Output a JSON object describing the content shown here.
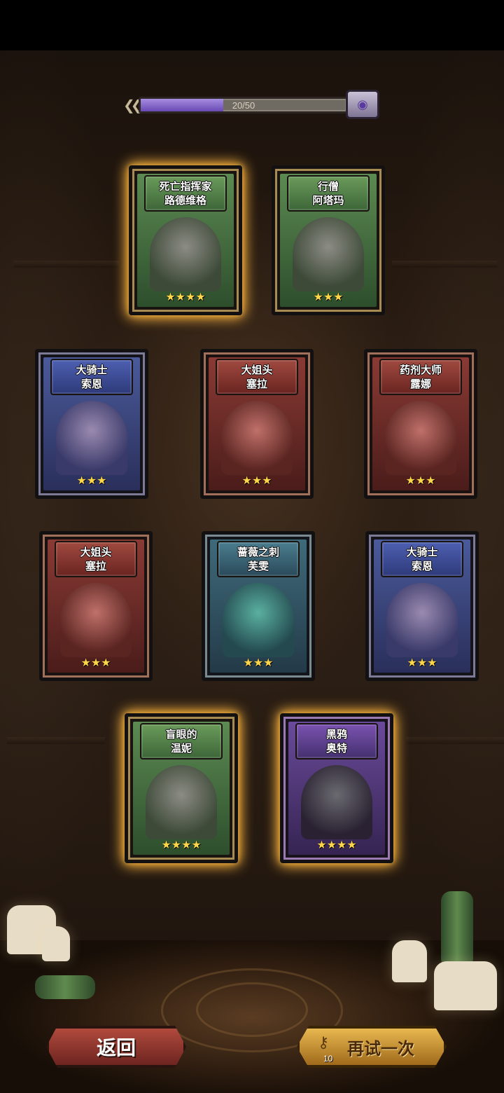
{
  "progress": {
    "text": "20/50",
    "value": 20,
    "max": 50,
    "fill_color": "#7a56c6"
  },
  "cards": [
    {
      "name_line1": "死亡指挥家",
      "name_line2": "路德维格",
      "stars": "★★★★",
      "rarity": "green",
      "highlighted": true
    },
    {
      "name_line1": "行僧",
      "name_line2": "阿塔玛",
      "stars": "★★★",
      "rarity": "green",
      "highlighted": false
    },
    {
      "name_line1": "大骑士",
      "name_line2": "索恩",
      "stars": "★★★",
      "rarity": "blue",
      "highlighted": false
    },
    {
      "name_line1": "大姐头",
      "name_line2": "塞拉",
      "stars": "★★★",
      "rarity": "red",
      "highlighted": false
    },
    {
      "name_line1": "药剂大师",
      "name_line2": "露娜",
      "stars": "★★★",
      "rarity": "red",
      "highlighted": false
    },
    {
      "name_line1": "大姐头",
      "name_line2": "塞拉",
      "stars": "★★★",
      "rarity": "red",
      "highlighted": false
    },
    {
      "name_line1": "蔷薇之刺",
      "name_line2": "芙雯",
      "stars": "★★★",
      "rarity": "teal",
      "highlighted": false
    },
    {
      "name_line1": "大骑士",
      "name_line2": "索恩",
      "stars": "★★★",
      "rarity": "blue",
      "highlighted": false
    },
    {
      "name_line1": "盲眼的",
      "name_line2": "温妮",
      "stars": "★★★★",
      "rarity": "green",
      "highlighted": true
    },
    {
      "name_line1": "黑鸦",
      "name_line2": "奥特",
      "stars": "★★★★",
      "rarity": "purple",
      "highlighted": true
    }
  ],
  "buttons": {
    "back_label": "返回",
    "retry_label": "再试一次",
    "retry_cost": "10",
    "retry_icon": "key-icon"
  }
}
